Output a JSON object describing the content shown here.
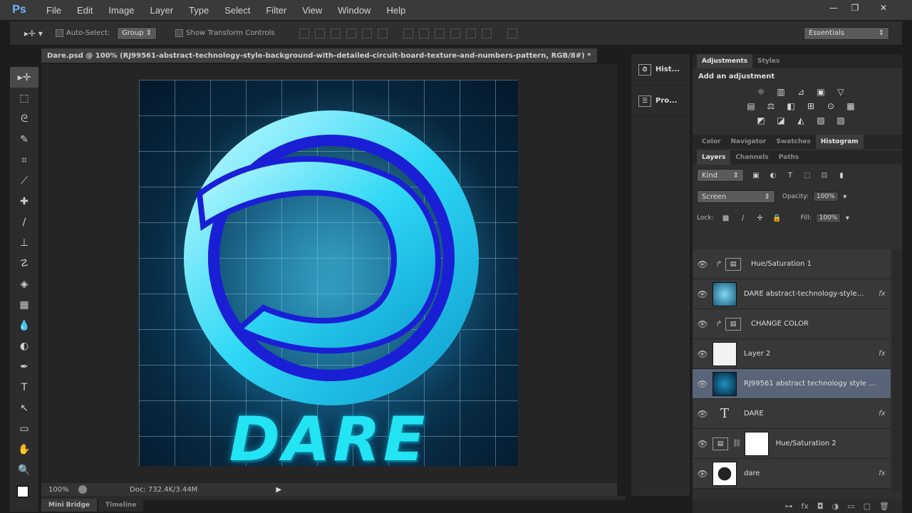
{
  "menubar": {
    "logo": "Ps",
    "items": [
      "File",
      "Edit",
      "Image",
      "Layer",
      "Type",
      "Select",
      "Filter",
      "View",
      "Window",
      "Help"
    ],
    "window_controls": [
      "—",
      "❐",
      "✕"
    ]
  },
  "options": {
    "auto_select_label": "Auto-Select:",
    "auto_select_value": "Group",
    "show_transform_label": "Show Transform Controls",
    "workspace": "Essentials"
  },
  "tools": [
    "move-icon",
    "marquee-icon",
    "lasso-icon",
    "quick-select-icon",
    "crop-icon",
    "eyedropper-icon",
    "healing-icon",
    "brush-icon",
    "stamp-icon",
    "history-brush-icon",
    "eraser-icon",
    "gradient-icon",
    "blur-icon",
    "dodge-icon",
    "pen-icon",
    "type-icon",
    "path-select-icon",
    "shape-icon",
    "hand-icon",
    "zoom-icon"
  ],
  "tool_glyphs": [
    "▸✛",
    "⬚",
    "ᘓ",
    "✎",
    "⌗",
    "⟋",
    "✚",
    "∕",
    "⊥",
    "☡",
    "◈",
    "▦",
    "💧",
    "◐",
    "✒",
    "T",
    "↖",
    "▭",
    "✋",
    "🔍"
  ],
  "document": {
    "tab_title": "Dare.psd @ 100% (RJ99561-abstract-technology-style-background-with-detailed-circuit-board-texture-and-numbers-pattern, RGB/8#) *",
    "close": "×",
    "artwork_text": "DARE",
    "zoom": "100%",
    "doc_size": "Doc: 732.4K/3.44M"
  },
  "bottom_tabs": [
    "Mini Bridge",
    "Timeline"
  ],
  "mid_panels": [
    {
      "label": "Hist...",
      "icon": "history-panel-icon"
    },
    {
      "label": "Pro...",
      "icon": "properties-panel-icon"
    }
  ],
  "adjustments": {
    "tabs": [
      "Adjustments",
      "Styles"
    ],
    "title": "Add an adjustment",
    "row1": [
      "☼",
      "▥",
      "⊿",
      "▣",
      "▽"
    ],
    "row2": [
      "▤",
      "⚖",
      "◧",
      "⊞",
      "⊙",
      "▦"
    ],
    "row3": [
      "◩",
      "◪",
      "◭",
      "▧",
      "▨"
    ]
  },
  "info_tabs": [
    "Color",
    "Navigator",
    "Swatches",
    "Histogram"
  ],
  "layers_tabs": [
    "Layers",
    "Channels",
    "Paths"
  ],
  "layers_panel": {
    "kind": "Kind",
    "blend_mode": "Screen",
    "opacity_label": "Opacity:",
    "opacity": "100%",
    "lock_label": "Lock:",
    "fill_label": "Fill:",
    "fill": "100%"
  },
  "layers": [
    {
      "name": "Hue/Saturation 1",
      "type": "adjustment",
      "clipped": true,
      "fx": false,
      "selected": false
    },
    {
      "name": "DARE abstract-technology-style...",
      "type": "image",
      "clipped": false,
      "fx": true,
      "selected": false
    },
    {
      "name": "CHANGE COLOR",
      "type": "adjustment",
      "clipped": true,
      "fx": false,
      "selected": false
    },
    {
      "name": "Layer 2",
      "type": "image",
      "clipped": false,
      "fx": true,
      "selected": false
    },
    {
      "name": "RJ99561 abstract technology style ...",
      "type": "image",
      "clipped": false,
      "fx": false,
      "selected": true
    },
    {
      "name": "DARE",
      "type": "text",
      "clipped": false,
      "fx": true,
      "selected": false
    },
    {
      "name": "Hue/Saturation 2",
      "type": "adjustment-mask",
      "clipped": false,
      "fx": false,
      "selected": false
    },
    {
      "name": "dare",
      "type": "image",
      "clipped": false,
      "fx": true,
      "selected": false
    }
  ],
  "layer_footer": [
    "⊶",
    "fx",
    "◘",
    "◑",
    "▭",
    "▢",
    "🗑"
  ],
  "colors": {
    "accent": "#6fb7ff",
    "artwork_text": "#22e4f2",
    "selected_layer": "#5a6478"
  }
}
